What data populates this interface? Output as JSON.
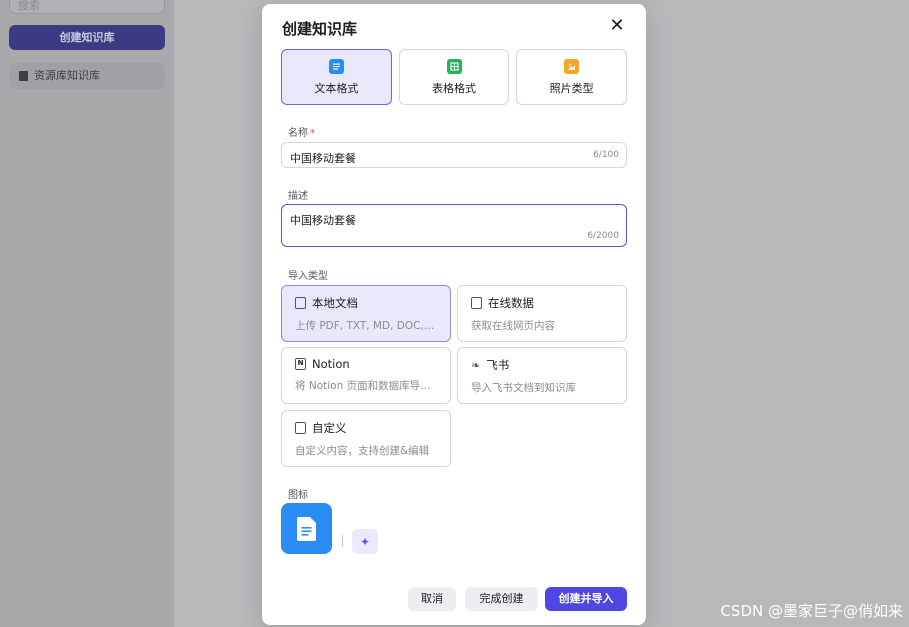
{
  "background": {
    "search_placeholder": "搜索",
    "create_button": "创建知识库",
    "library_item": "资源库知识库"
  },
  "modal": {
    "title": "创建知识库",
    "format_tabs": [
      {
        "label": "文本格式",
        "icon": "document-icon",
        "color": "#2a8df5",
        "active": true
      },
      {
        "label": "表格格式",
        "icon": "table-icon",
        "color": "#22b35e",
        "active": false
      },
      {
        "label": "照片类型",
        "icon": "image-icon",
        "color": "#f5a623",
        "active": false
      }
    ],
    "name_field": {
      "label": "名称",
      "required_mark": "*",
      "value": "中国移动套餐",
      "counter": "6/100"
    },
    "description_field": {
      "label": "描述",
      "value": "中国移动套餐",
      "counter": "6/2000"
    },
    "import_type": {
      "label": "导入类型",
      "options": [
        {
          "title": "本地文档",
          "desc": "上传 PDF, TXT, MD, DOC, DOCX 格式的本地文件",
          "active": true
        },
        {
          "title": "在线数据",
          "desc": "获取在线网页内容",
          "active": false
        },
        {
          "title": "Notion",
          "desc": "将 Notion 页面和数据库导入到知识库",
          "active": false
        },
        {
          "title": "飞书",
          "desc": "导入飞书文档到知识库",
          "active": false
        },
        {
          "title": "自定义",
          "desc": "自定义内容，支持创建&编辑",
          "active": false
        }
      ]
    },
    "icon_field": {
      "label": "图标"
    },
    "buttons": {
      "cancel": "取消",
      "finish": "完成创建",
      "create_import": "创建并导入"
    }
  },
  "watermark": "CSDN @墨家巨子@俏如来",
  "colors": {
    "accent": "#4f46e5",
    "active_bg": "#e8e8fb",
    "icon_blue": "#2a8df5"
  }
}
